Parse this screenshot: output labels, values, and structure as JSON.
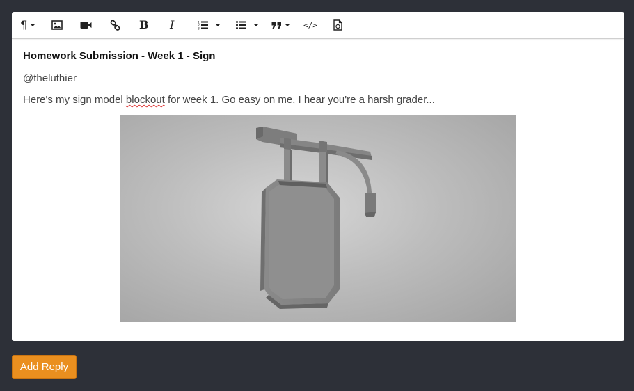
{
  "toolbar": {
    "buttons": [
      {
        "name": "paragraph-format",
        "icon": "pilcrow-icon",
        "glyph": "¶",
        "has_dropdown": true
      },
      {
        "name": "insert-image",
        "icon": "image-icon"
      },
      {
        "name": "insert-video",
        "icon": "video-icon"
      },
      {
        "name": "insert-link",
        "icon": "link-icon"
      },
      {
        "name": "bold",
        "icon": "bold-icon",
        "glyph": "B"
      },
      {
        "name": "italic",
        "icon": "italic-icon",
        "glyph": "I"
      },
      {
        "name": "ordered-list",
        "icon": "ordered-list-icon",
        "has_dropdown": true
      },
      {
        "name": "unordered-list",
        "icon": "unordered-list-icon",
        "has_dropdown": true
      },
      {
        "name": "quote",
        "icon": "quote-icon",
        "has_dropdown": true
      },
      {
        "name": "code-view",
        "icon": "code-icon",
        "glyph": "</>"
      },
      {
        "name": "insert-file",
        "icon": "file-icon"
      }
    ]
  },
  "post": {
    "title": "Homework Submission - Week 1 - Sign",
    "mention": "@theluthier",
    "body_before": "Here's my sign model ",
    "body_misspelled": "blockout",
    "body_after": " for week 1. Go easy on me, I hear you're a harsh grader...",
    "image_subject": "3d-hanging-sign-model"
  },
  "actions": {
    "add_reply_label": "Add Reply"
  },
  "colors": {
    "page_background": "#2d3038",
    "editor_background": "#ffffff",
    "button_accent": "#ea8f1f",
    "spellcheck_underline": "#dd3333"
  }
}
